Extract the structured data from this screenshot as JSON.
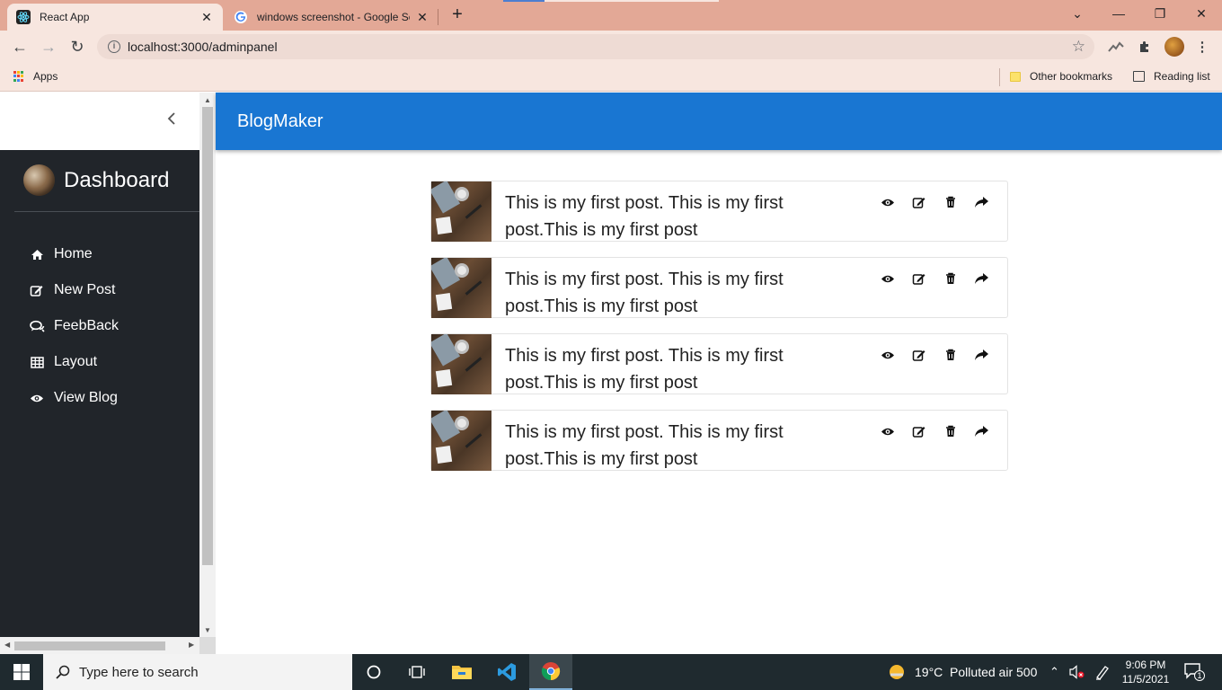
{
  "browser": {
    "tabs": [
      {
        "label": "React App",
        "active": true
      },
      {
        "label": "windows screenshot - Google Se",
        "active": false
      }
    ],
    "url": "localhost:3000/adminpanel",
    "bookmarks": {
      "apps": "Apps",
      "other": "Other bookmarks",
      "reading_list": "Reading list"
    }
  },
  "sidebar": {
    "title": "Dashboard",
    "items": [
      {
        "label": "Home",
        "icon": "home-icon"
      },
      {
        "label": "New Post",
        "icon": "edit-icon"
      },
      {
        "label": "FeebBack",
        "icon": "comments-icon"
      },
      {
        "label": "Layout",
        "icon": "table-icon"
      },
      {
        "label": "View Blog",
        "icon": "eye-icon"
      }
    ]
  },
  "appbar": {
    "title": "BlogMaker"
  },
  "posts": [
    {
      "text": "This is my first post. This is my first post.This is my first post"
    },
    {
      "text": "This is my first post. This is my first post.This is my first post"
    },
    {
      "text": "This is my first post. This is my first post.This is my first post"
    },
    {
      "text": "This is my first post. This is my first post.This is my first post"
    }
  ],
  "taskbar": {
    "search_placeholder": "Type here to search",
    "weather": "19°C  Polluted air 500",
    "time": "9:06 PM",
    "date": "11/5/2021",
    "notifications": "1"
  },
  "colors": {
    "appbar": "#1976d2",
    "sidebar": "#21252a",
    "tabbar": "#e3a896"
  }
}
